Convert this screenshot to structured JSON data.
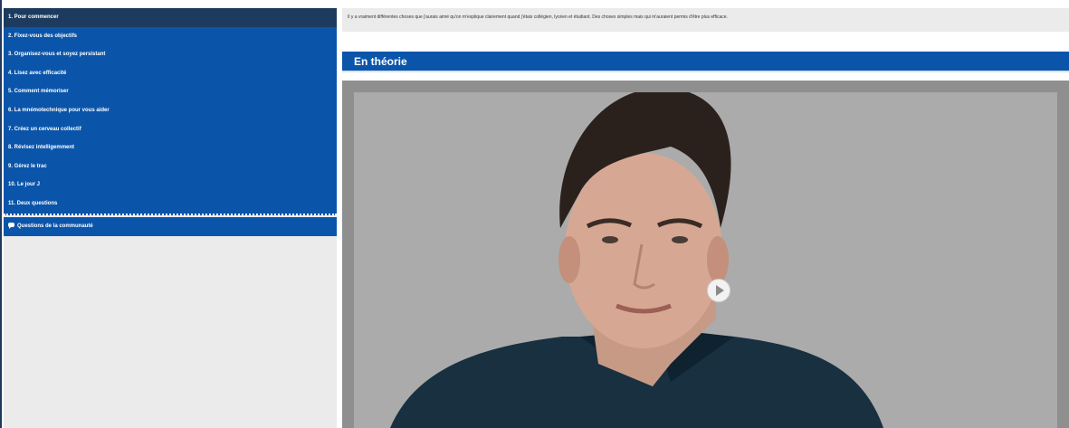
{
  "sidebar": {
    "items": [
      {
        "label": "1. Pour commencer"
      },
      {
        "label": "2. Fixez-vous des objectifs"
      },
      {
        "label": "3. Organisez-vous et soyez persistant"
      },
      {
        "label": "4. Lisez avec efficacité"
      },
      {
        "label": "5. Comment mémoriser"
      },
      {
        "label": "6. La mnémotechnique pour vous aider"
      },
      {
        "label": "7. Créez un cerveau collectif"
      },
      {
        "label": "8. Révisez intelligemment"
      },
      {
        "label": "9. Gérez le trac"
      },
      {
        "label": "10. Le jour J"
      },
      {
        "label": "11. Deux questions"
      }
    ],
    "community": {
      "label": "Questions de la communauté",
      "icon": "chat-icon"
    }
  },
  "main": {
    "intro_text": "Il y a vraiment différentes choses que j'aurais aimé qu'on m'explique clairement quand j'étais collégien, lycéen et étudiant. Des choses simples mais qui m'auraient permis d'être plus efficace.",
    "section_title": "En théorie"
  },
  "colors": {
    "nav_blue": "#0a55aa",
    "nav_active": "#1c3b5e",
    "panel_gray": "#ebebeb",
    "video_bg": "#a9a9a9"
  }
}
